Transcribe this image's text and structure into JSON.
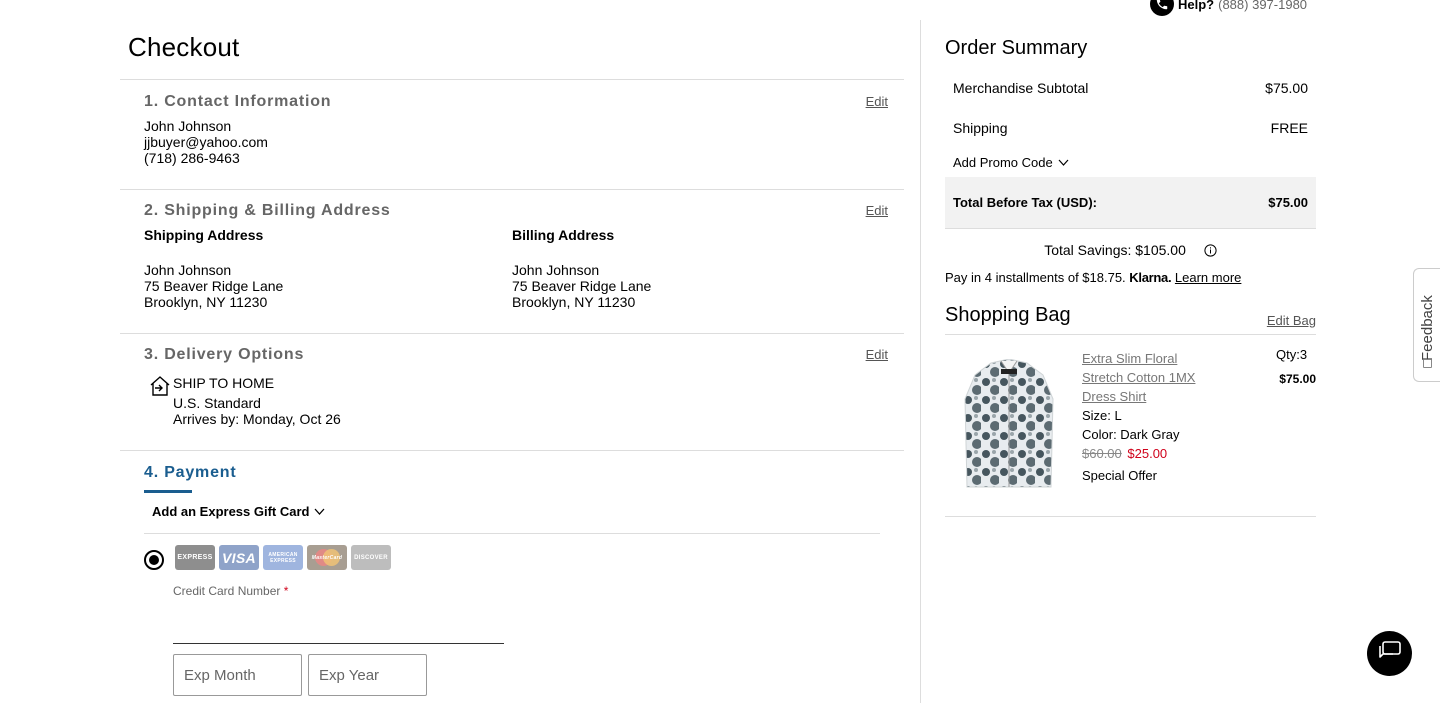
{
  "help": {
    "label": "Help?",
    "phone": "(888) 397-1980"
  },
  "page_title": "Checkout",
  "contact": {
    "heading": "1. Contact Information",
    "edit": "Edit",
    "name": "John Johnson",
    "email": "jjbuyer@yahoo.com",
    "phone": "(718) 286-9463"
  },
  "address": {
    "heading": "2. Shipping & Billing Address",
    "edit": "Edit",
    "shipping": {
      "title": "Shipping Address",
      "name": "John Johnson",
      "street": "75 Beaver Ridge Lane",
      "city": "Brooklyn, NY 11230"
    },
    "billing": {
      "title": "Billing Address",
      "name": "John Johnson",
      "street": "75 Beaver Ridge Lane",
      "city": "Brooklyn, NY 11230"
    }
  },
  "delivery": {
    "heading": "3. Delivery Options",
    "edit": "Edit",
    "method": "SHIP TO HOME",
    "service": "U.S. Standard",
    "arrives": "Arrives by: Monday, Oct 26"
  },
  "payment": {
    "heading": "4. Payment",
    "gift_card": "Add an Express Gift Card",
    "cards": [
      "EXPRESS",
      "VISA",
      "AMERICAN EXPRESS",
      "MasterCard",
      "DISCOVER"
    ],
    "cc_label": "Credit Card Number",
    "required_mark": "*",
    "exp_month_placeholder": "Exp Month",
    "exp_year_placeholder": "Exp Year"
  },
  "summary": {
    "title": "Order Summary",
    "subtotal_label": "Merchandise Subtotal",
    "subtotal_value": "$75.00",
    "shipping_label": "Shipping",
    "shipping_value": "FREE",
    "promo": "Add Promo Code",
    "total_label": "Total Before Tax (USD):",
    "total_value": "$75.00",
    "savings": "Total Savings: $105.00",
    "klarna_text": "Pay in 4 installments of $18.75.",
    "klarna_brand": "Klarna.",
    "learn_more": "Learn more"
  },
  "bag": {
    "title": "Shopping Bag",
    "edit": "Edit Bag",
    "item": {
      "name_line1": "Extra Slim Floral",
      "name_line2": "Stretch Cotton 1MX",
      "name_line3": "Dress Shirt",
      "size": "Size: L",
      "color": "Color: Dark Gray",
      "original_price": "$60.00",
      "sale_price": "$25.00",
      "offer": "Special Offer",
      "qty": "Qty:3",
      "total": "$75.00"
    }
  },
  "feedback": "Feedback",
  "colors": {
    "accent": "#1a5d8f",
    "sale": "#d0021b",
    "grey_text": "#666666"
  }
}
